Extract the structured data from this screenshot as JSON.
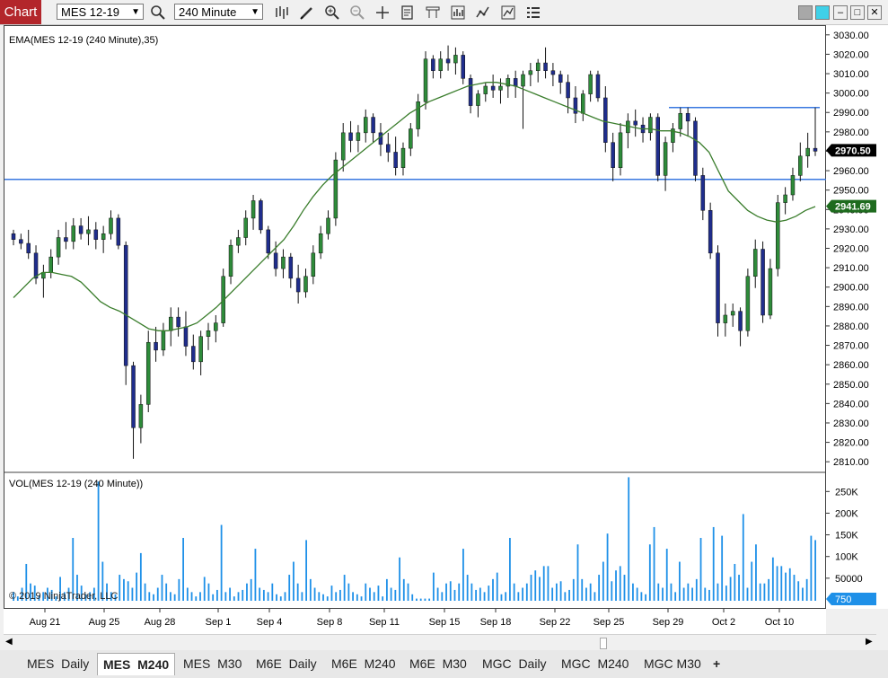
{
  "toolbar": {
    "chart_tag": "Chart",
    "instrument": "MES 12-19",
    "interval": "240 Minute",
    "icons": [
      "search-icon",
      "bars-type-icon",
      "draw-pencil-icon",
      "zoom-in-icon",
      "zoom-out-icon",
      "crosshair-icon",
      "data-box-icon",
      "templates-icon",
      "strategies-icon",
      "indicators-icon",
      "properties-icon"
    ],
    "window_buttons": [
      "gray-square",
      "cyan-square",
      "minimize",
      "maximize",
      "close"
    ]
  },
  "price_panel": {
    "indicator_label": "EMA(MES 12-19 (240 Minute),35)",
    "current_price_label": "2970.50",
    "ema_label": "2941.69",
    "horizontal_line_1": 2956,
    "horizontal_line_2": 2993,
    "y_ticks": [
      "3030.00",
      "3020.00",
      "3010.00",
      "3000.00",
      "2990.00",
      "2980.00",
      "2970.00",
      "2960.00",
      "2950.00",
      "2940.00",
      "2930.00",
      "2920.00",
      "2910.00",
      "2900.00",
      "2890.00",
      "2880.00",
      "2870.00",
      "2860.00",
      "2850.00",
      "2840.00",
      "2830.00",
      "2820.00",
      "2810.00"
    ]
  },
  "volume_panel": {
    "indicator_label": "VOL(MES 12-19 (240 Minute))",
    "volume_label": "750",
    "y_ticks": [
      "250K",
      "200K",
      "150K",
      "100K",
      "50000"
    ],
    "copyright": "© 2019 NinjaTrader, LLC"
  },
  "x_axis": {
    "labels": [
      "Aug 21",
      "Aug 25",
      "Aug 28",
      "Sep 1",
      "Sep 4",
      "Sep 8",
      "Sep 11",
      "Sep 15",
      "Sep 18",
      "Sep 22",
      "Sep 25",
      "Sep 29",
      "Oct 2",
      "Oct 10"
    ]
  },
  "tabs": [
    {
      "label": "MES  Daily",
      "active": false
    },
    {
      "label": "MES  M240",
      "active": true
    },
    {
      "label": "MES  M30",
      "active": false
    },
    {
      "label": "M6E  Daily",
      "active": false
    },
    {
      "label": "M6E  M240",
      "active": false
    },
    {
      "label": "M6E  M30",
      "active": false
    },
    {
      "label": "MGC  Daily",
      "active": false
    },
    {
      "label": "MGC  M240",
      "active": false
    },
    {
      "label": "MGC M30",
      "active": false
    },
    {
      "label": "+",
      "active": false
    }
  ],
  "colors": {
    "up_candle": "#2e8b3a",
    "down_candle": "#1f2d8c",
    "ema_line": "#3a7d2c",
    "hline": "#3a78e0",
    "volume_bar": "#1e90e8",
    "price_badge": "#000000",
    "ema_badge": "#1e6b1e",
    "volume_badge": "#1e90e8",
    "chart_tag": "#b3262b"
  },
  "chart_data": {
    "type": "candlestick",
    "price_key": [
      "open",
      "high",
      "low",
      "close"
    ],
    "candles": [
      [
        2928,
        2930,
        2922,
        2925
      ],
      [
        2925,
        2928,
        2920,
        2923
      ],
      [
        2923,
        2930,
        2915,
        2918
      ],
      [
        2918,
        2922,
        2902,
        2905
      ],
      [
        2905,
        2912,
        2895,
        2908
      ],
      [
        2908,
        2920,
        2905,
        2916
      ],
      [
        2916,
        2930,
        2912,
        2926
      ],
      [
        2926,
        2934,
        2920,
        2924
      ],
      [
        2924,
        2936,
        2920,
        2932
      ],
      [
        2932,
        2936,
        2925,
        2928
      ],
      [
        2928,
        2937,
        2922,
        2930
      ],
      [
        2930,
        2934,
        2920,
        2925
      ],
      [
        2925,
        2932,
        2918,
        2928
      ],
      [
        2928,
        2940,
        2925,
        2936
      ],
      [
        2936,
        2938,
        2920,
        2922
      ],
      [
        2922,
        2924,
        2850,
        2860
      ],
      [
        2860,
        2862,
        2812,
        2828
      ],
      [
        2828,
        2845,
        2820,
        2840
      ],
      [
        2840,
        2878,
        2836,
        2872
      ],
      [
        2872,
        2880,
        2862,
        2868
      ],
      [
        2868,
        2882,
        2865,
        2878
      ],
      [
        2878,
        2890,
        2870,
        2885
      ],
      [
        2885,
        2890,
        2875,
        2880
      ],
      [
        2880,
        2888,
        2865,
        2870
      ],
      [
        2870,
        2876,
        2858,
        2862
      ],
      [
        2862,
        2878,
        2855,
        2875
      ],
      [
        2875,
        2882,
        2868,
        2878
      ],
      [
        2878,
        2886,
        2872,
        2882
      ],
      [
        2882,
        2910,
        2880,
        2906
      ],
      [
        2906,
        2925,
        2902,
        2922
      ],
      [
        2922,
        2930,
        2918,
        2926
      ],
      [
        2926,
        2940,
        2922,
        2936
      ],
      [
        2936,
        2948,
        2930,
        2945
      ],
      [
        2945,
        2946,
        2928,
        2930
      ],
      [
        2930,
        2932,
        2915,
        2918
      ],
      [
        2918,
        2924,
        2906,
        2910
      ],
      [
        2910,
        2920,
        2905,
        2916
      ],
      [
        2916,
        2918,
        2900,
        2905
      ],
      [
        2905,
        2912,
        2892,
        2898
      ],
      [
        2898,
        2910,
        2895,
        2906
      ],
      [
        2906,
        2922,
        2902,
        2918
      ],
      [
        2918,
        2932,
        2915,
        2928
      ],
      [
        2928,
        2940,
        2925,
        2936
      ],
      [
        2936,
        2970,
        2932,
        2966
      ],
      [
        2966,
        2985,
        2960,
        2980
      ],
      [
        2980,
        2986,
        2970,
        2976
      ],
      [
        2976,
        2984,
        2970,
        2980
      ],
      [
        2980,
        2992,
        2975,
        2988
      ],
      [
        2988,
        2990,
        2975,
        2980
      ],
      [
        2980,
        2985,
        2968,
        2974
      ],
      [
        2974,
        2980,
        2965,
        2970
      ],
      [
        2970,
        2978,
        2958,
        2962
      ],
      [
        2962,
        2975,
        2958,
        2972
      ],
      [
        2972,
        2985,
        2968,
        2982
      ],
      [
        2982,
        3000,
        2978,
        2996
      ],
      [
        2996,
        3022,
        2992,
        3018
      ],
      [
        3018,
        3020,
        3008,
        3012
      ],
      [
        3012,
        3022,
        3008,
        3018
      ],
      [
        3018,
        3025,
        3012,
        3016
      ],
      [
        3016,
        3024,
        3010,
        3020
      ],
      [
        3020,
        3022,
        3005,
        3008
      ],
      [
        3008,
        3010,
        2990,
        2994
      ],
      [
        2994,
        3002,
        2988,
        3000
      ],
      [
        3000,
        3006,
        2996,
        3004
      ],
      [
        3004,
        3010,
        2998,
        3002
      ],
      [
        3002,
        3008,
        2995,
        3004
      ],
      [
        3004,
        3010,
        2998,
        3008
      ],
      [
        3008,
        3012,
        2998,
        3004
      ],
      [
        3004,
        3012,
        2982,
        3010
      ],
      [
        3010,
        3016,
        3004,
        3012
      ],
      [
        3012,
        3018,
        3006,
        3016
      ],
      [
        3016,
        3024,
        3008,
        3012
      ],
      [
        3012,
        3016,
        3004,
        3010
      ],
      [
        3010,
        3012,
        3000,
        3006
      ],
      [
        3006,
        3010,
        2990,
        2998
      ],
      [
        2998,
        3004,
        2985,
        2990
      ],
      [
        2990,
        3002,
        2986,
        3000
      ],
      [
        3000,
        3012,
        2996,
        3010
      ],
      [
        3010,
        3012,
        2996,
        2998
      ],
      [
        2998,
        3004,
        2970,
        2975
      ],
      [
        2975,
        2980,
        2955,
        2962
      ],
      [
        2962,
        2985,
        2958,
        2980
      ],
      [
        2980,
        2990,
        2972,
        2986
      ],
      [
        2986,
        2992,
        2978,
        2984
      ],
      [
        2984,
        2988,
        2975,
        2980
      ],
      [
        2980,
        2990,
        2976,
        2988
      ],
      [
        2988,
        2990,
        2955,
        2958
      ],
      [
        2958,
        2978,
        2950,
        2975
      ],
      [
        2975,
        2985,
        2970,
        2982
      ],
      [
        2982,
        2993,
        2978,
        2990
      ],
      [
        2990,
        2993,
        2978,
        2986
      ],
      [
        2986,
        2988,
        2955,
        2958
      ],
      [
        2958,
        2962,
        2935,
        2940
      ],
      [
        2940,
        2944,
        2915,
        2918
      ],
      [
        2918,
        2922,
        2875,
        2882
      ],
      [
        2882,
        2892,
        2875,
        2886
      ],
      [
        2886,
        2892,
        2880,
        2888
      ],
      [
        2888,
        2890,
        2870,
        2878
      ],
      [
        2878,
        2910,
        2875,
        2906
      ],
      [
        2906,
        2925,
        2900,
        2920
      ],
      [
        2920,
        2924,
        2882,
        2886
      ],
      [
        2886,
        2915,
        2884,
        2910
      ],
      [
        2910,
        2948,
        2906,
        2944
      ],
      [
        2944,
        2952,
        2938,
        2948
      ],
      [
        2948,
        2962,
        2945,
        2958
      ],
      [
        2958,
        2975,
        2955,
        2968
      ],
      [
        2968,
        2980,
        2962,
        2972
      ],
      [
        2972,
        2993,
        2968,
        2970.5
      ]
    ],
    "ema_values": [
      2895,
      2900,
      2905,
      2908,
      2908,
      2907,
      2906,
      2903,
      2898,
      2893,
      2890,
      2888,
      2885,
      2882,
      2879,
      2878,
      2878,
      2879,
      2880,
      2882,
      2886,
      2890,
      2895,
      2900,
      2905,
      2910,
      2915,
      2920,
      2925,
      2932,
      2940,
      2947,
      2953,
      2958,
      2962,
      2966,
      2970,
      2974,
      2978,
      2982,
      2986,
      2990,
      2993,
      2996,
      2998,
      3000,
      3002,
      3004,
      3005,
      3006,
      3006,
      3005,
      3004,
      3002,
      3000,
      2998,
      2996,
      2994,
      2992,
      2990,
      2988,
      2986,
      2985,
      2984,
      2983,
      2982,
      2982,
      2981,
      2981,
      2980,
      2978,
      2975,
      2970,
      2960,
      2950,
      2945,
      2940,
      2937,
      2935,
      2934,
      2935,
      2937,
      2940,
      2942
    ],
    "volumes": [
      20,
      10,
      30,
      85,
      40,
      35,
      12,
      20,
      30,
      25,
      10,
      55,
      20,
      30,
      145,
      60,
      35,
      15,
      20,
      30,
      275,
      90,
      40,
      20,
      15,
      60,
      50,
      45,
      30,
      65,
      110,
      40,
      20,
      15,
      30,
      60,
      40,
      20,
      15,
      50,
      145,
      30,
      20,
      10,
      20,
      55,
      40,
      15,
      25,
      175,
      20,
      30,
      10,
      20,
      25,
      40,
      50,
      120,
      30,
      25,
      20,
      40,
      15,
      10,
      20,
      60,
      90,
      40,
      20,
      140,
      50,
      30,
      20,
      15,
      10,
      35,
      20,
      25,
      60,
      40,
      20,
      15,
      10,
      40,
      30,
      20,
      35,
      10,
      50,
      30,
      25,
      100,
      50,
      40,
      15,
      5,
      5,
      5,
      5,
      65,
      30,
      20,
      40,
      45,
      25,
      40,
      120,
      60,
      40,
      25,
      30,
      20,
      35,
      50,
      65,
      15,
      20,
      145,
      40,
      20,
      30,
      40,
      60,
      70,
      55,
      80,
      80,
      30,
      40,
      45,
      20,
      25,
      50,
      130,
      50,
      30,
      40,
      20,
      60,
      90,
      155,
      45,
      70,
      80,
      60,
      285,
      40,
      30,
      20,
      15,
      130,
      170,
      40,
      30,
      120,
      40,
      20,
      90,
      30,
      40,
      30,
      50,
      145,
      30,
      25,
      170,
      40,
      150,
      35,
      55,
      85,
      60,
      200,
      30,
      90,
      130,
      40,
      40,
      50,
      100,
      80,
      80,
      65,
      75,
      60,
      45,
      30,
      50,
      150,
      140
    ],
    "y_range": [
      2805,
      3035
    ],
    "volume_range": [
      0,
      290000
    ]
  }
}
